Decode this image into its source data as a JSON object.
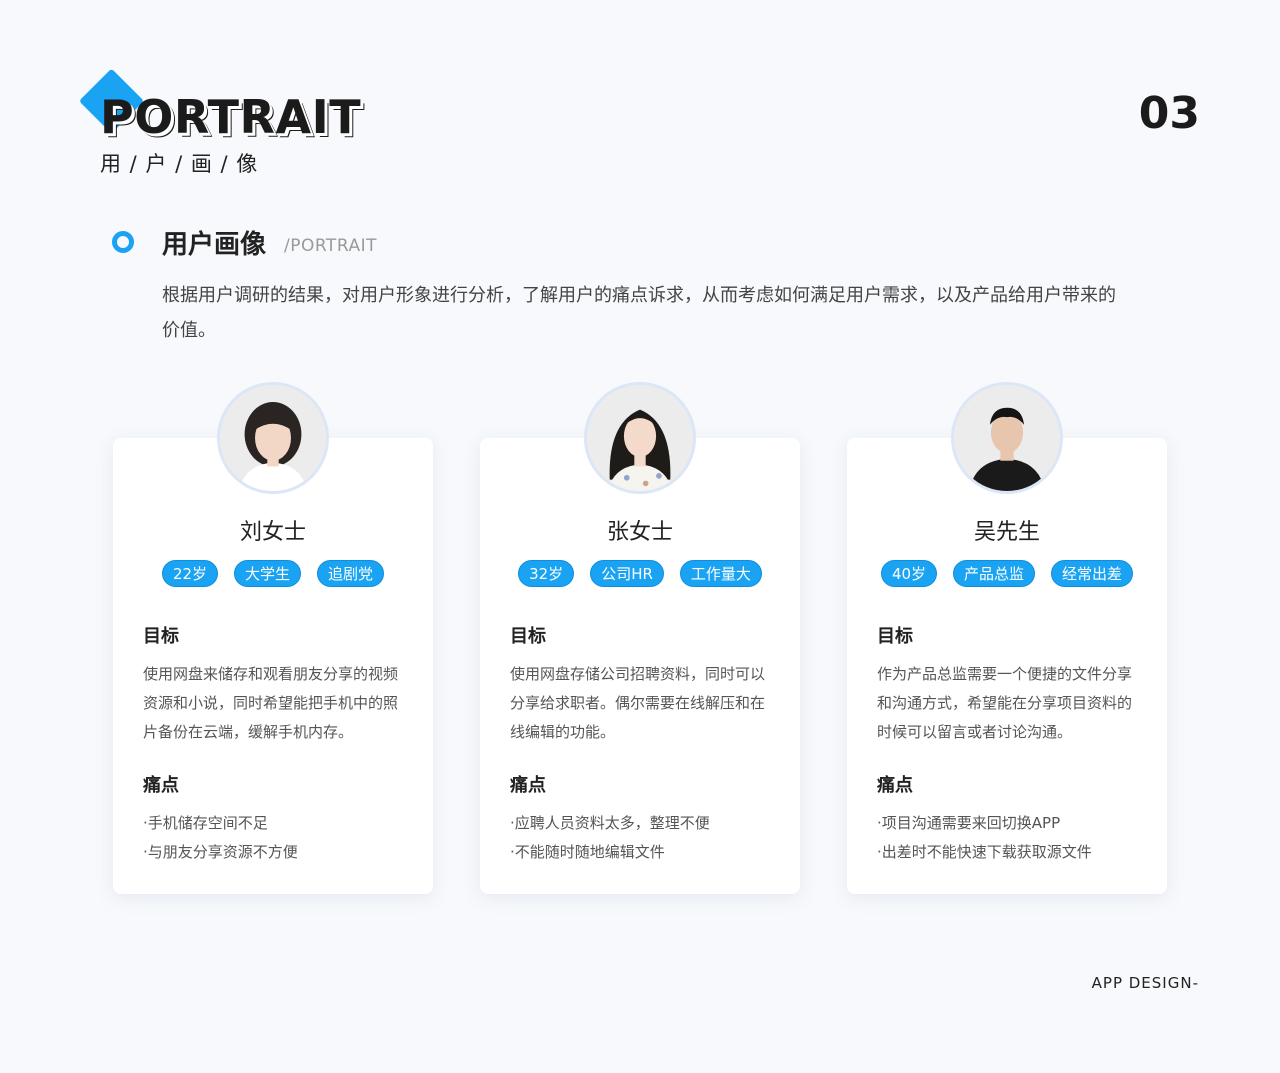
{
  "brand": {
    "word": "PORTRAIT",
    "sub": "用 / 户 / 画 / 像",
    "accent": "#1aa3f2"
  },
  "page_number": "03",
  "section": {
    "title": "用户画像",
    "subtitle": "/PORTRAIT",
    "intro": "根据用户调研的结果，对用户形象进行分析，了解用户的痛点诉求，从而考虑如何满足用户需求，以及产品给用户带来的价值。"
  },
  "personas": [
    {
      "name": "刘女士",
      "tags": [
        "22岁",
        "大学生",
        "追剧党"
      ],
      "goal_title": "目标",
      "goal": "使用网盘来储存和观看朋友分享的视频资源和小说，同时希望能把手机中的照片备份在云端，缓解手机内存。",
      "pain_title": "痛点",
      "pains": [
        "·手机储存空间不足",
        "·与朋友分享资源不方便"
      ]
    },
    {
      "name": "张女士",
      "tags": [
        "32岁",
        "公司HR",
        "工作量大"
      ],
      "goal_title": "目标",
      "goal": "使用网盘存储公司招聘资料，同时可以分享给求职者。偶尔需要在线解压和在线编辑的功能。",
      "pain_title": "痛点",
      "pains": [
        "·应聘人员资料太多，整理不便",
        "·不能随时随地编辑文件"
      ]
    },
    {
      "name": "吴先生",
      "tags": [
        "40岁",
        "产品总监",
        "经常出差"
      ],
      "goal_title": "目标",
      "goal": "作为产品总监需要一个便捷的文件分享和沟通方式，希望能在分享项目资料的时候可以留言或者讨论沟通。",
      "pain_title": "痛点",
      "pains": [
        "·项目沟通需要来回切换APP",
        "·出差时不能快速下载获取源文件"
      ]
    }
  ],
  "footer": "APP DESIGN-"
}
